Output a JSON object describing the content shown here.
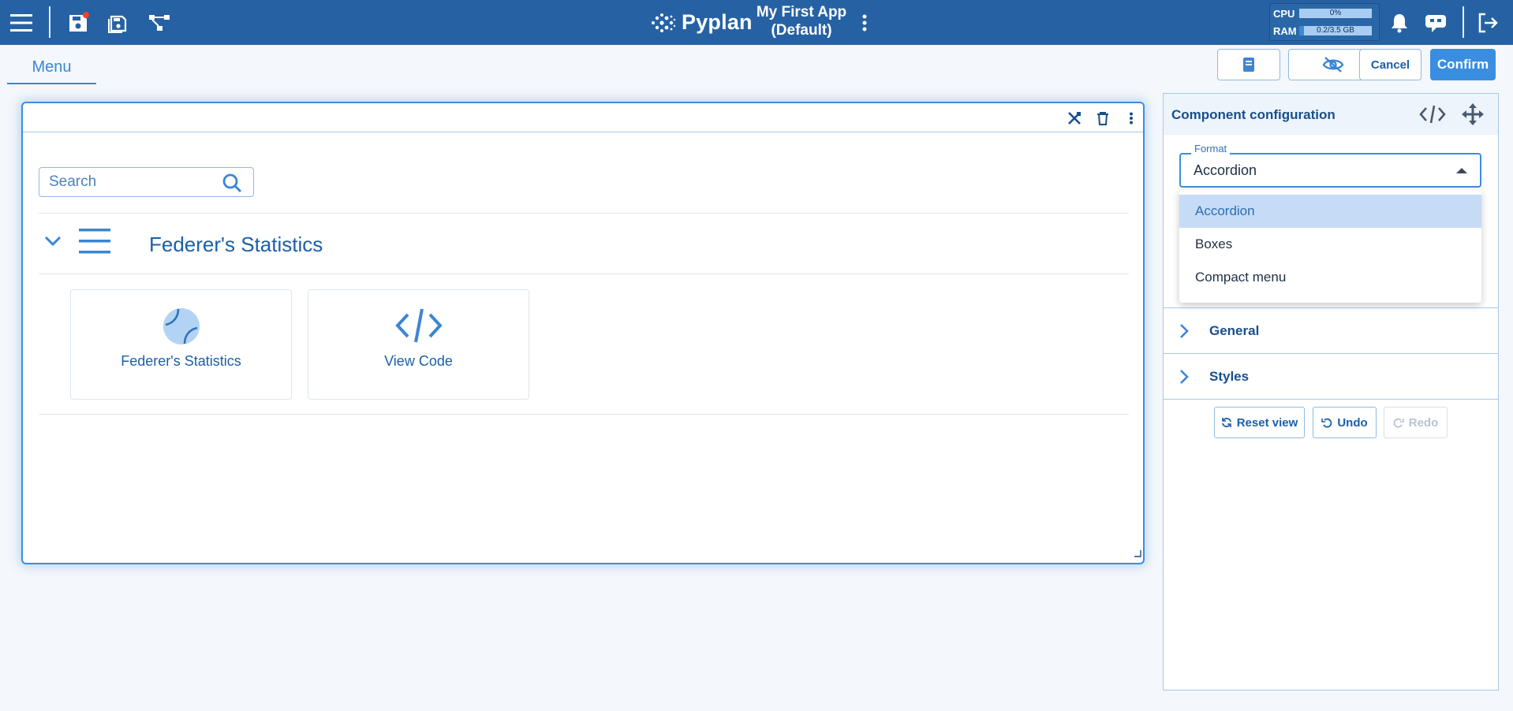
{
  "topbar": {
    "brand": "Pyplan",
    "app_title": "My First App",
    "app_subtitle": "(Default)",
    "cpu_label": "CPU",
    "cpu_value": "0%",
    "cpu_fraction": 0.0,
    "ram_label": "RAM",
    "ram_value": "0.2/3.5 GB",
    "ram_fraction": 0.06
  },
  "subbar": {
    "menu_tab": "Menu",
    "cancel_label": "Cancel",
    "confirm_label": "Confirm"
  },
  "component": {
    "search_placeholder": "Search",
    "accordion_title": "Federer's Statistics",
    "cards": [
      {
        "label": "Federer's Statistics",
        "icon": "tennis-ball-icon"
      },
      {
        "label": "View Code",
        "icon": "code-icon"
      }
    ]
  },
  "panel": {
    "title": "Component configuration",
    "format_label": "Format",
    "format_value": "Accordion",
    "format_options": [
      "Accordion",
      "Boxes",
      "Compact menu"
    ],
    "sections": [
      "General",
      "Styles"
    ],
    "reset_label": "Reset view",
    "undo_label": "Undo",
    "redo_label": "Redo"
  },
  "colors": {
    "topbar": "#2662a3",
    "accent": "#3a8ee0",
    "text": "#1b5fa8"
  }
}
